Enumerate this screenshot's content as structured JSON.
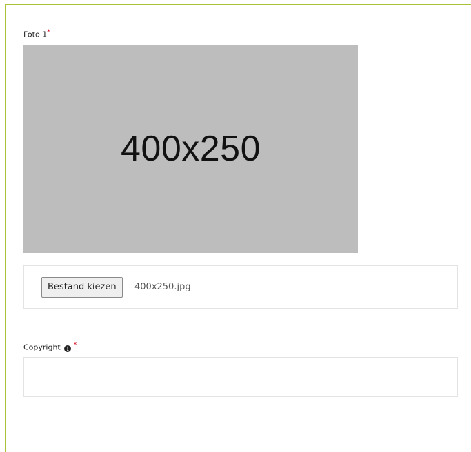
{
  "photo_field": {
    "label": "Foto 1",
    "required_mark": "*",
    "preview_text": "400x250",
    "choose_file_label": "Bestand kiezen",
    "file_name": "400x250.jpg"
  },
  "copyright_field": {
    "label": "Copyright",
    "info_icon": "info-icon",
    "required_mark": "*",
    "value": ""
  },
  "colors": {
    "frame_border": "#a8c23a",
    "required": "#d0021b",
    "preview_background": "#bdbdbd"
  }
}
